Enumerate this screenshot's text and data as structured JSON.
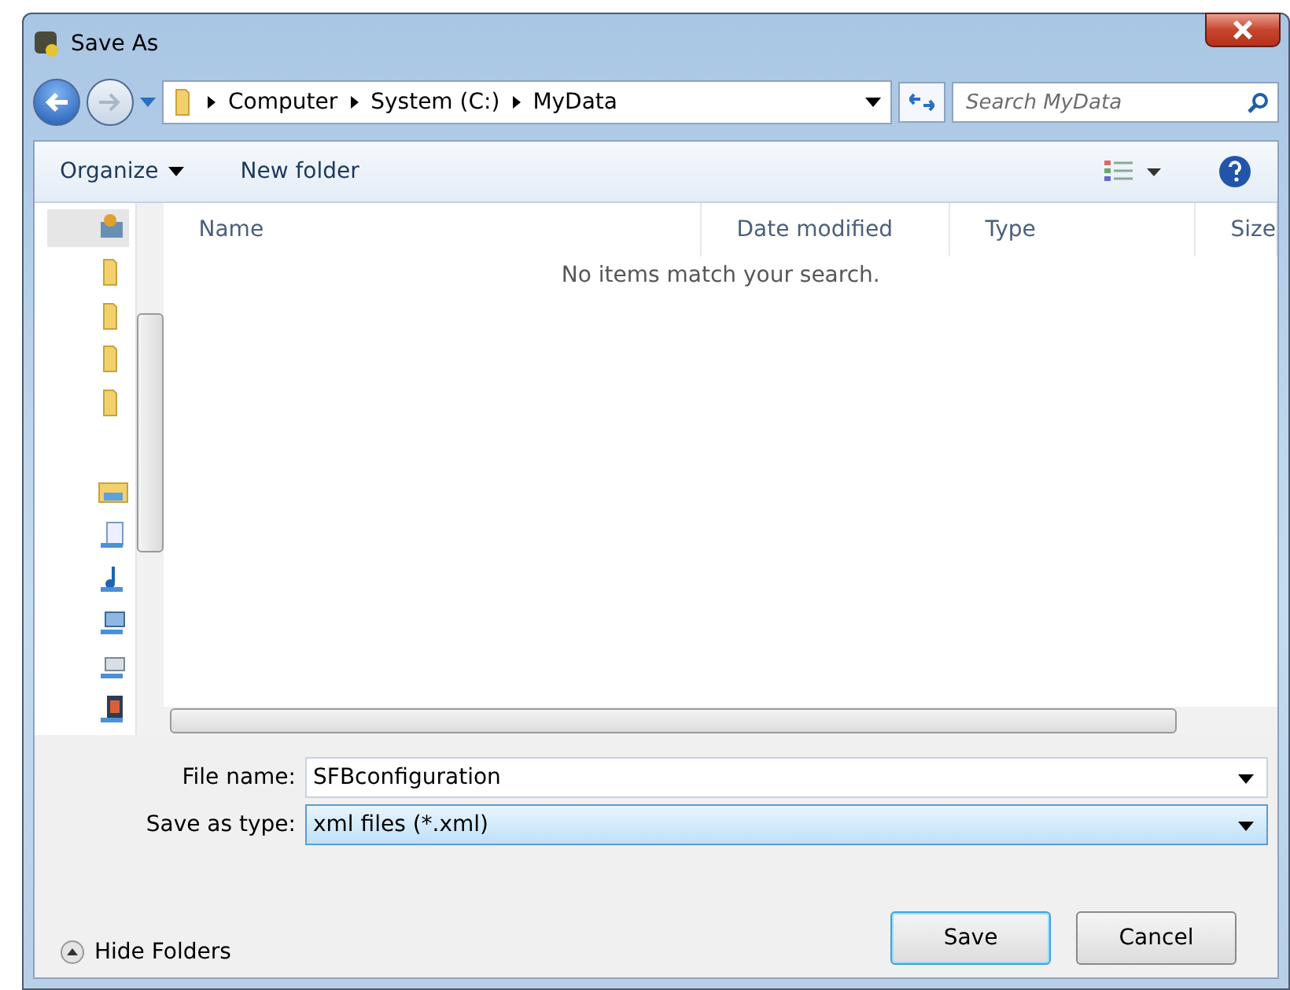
{
  "window": {
    "title": "Save As"
  },
  "address": {
    "crumbs": [
      "Computer",
      "System (C:)",
      "MyData"
    ]
  },
  "search": {
    "placeholder": "Search MyData"
  },
  "toolbar": {
    "organize": "Organize",
    "new_folder": "New folder"
  },
  "nav_pane": {
    "items": [
      {
        "kind": "library",
        "selected": true
      },
      {
        "kind": "folder",
        "selected": false
      },
      {
        "kind": "folder",
        "selected": false
      },
      {
        "kind": "folder",
        "selected": false
      },
      {
        "kind": "folder",
        "selected": false
      },
      {
        "kind": "libraries",
        "selected": false
      },
      {
        "kind": "document",
        "selected": false
      },
      {
        "kind": "music",
        "selected": false
      },
      {
        "kind": "computer",
        "selected": false
      },
      {
        "kind": "drive",
        "selected": false
      },
      {
        "kind": "video",
        "selected": false
      }
    ]
  },
  "table": {
    "columns": [
      "Name",
      "Date modified",
      "Type",
      "Size"
    ],
    "empty_message": "No items match your search."
  },
  "form": {
    "file_name_label": "File name:",
    "file_name": "SFBconfiguration",
    "type_label": "Save as type:",
    "type_value": "xml files (*.xml)"
  },
  "hide_folders": "Hide Folders",
  "buttons": [
    {
      "label": "Save",
      "default": true
    },
    {
      "label": "Cancel",
      "default": false
    }
  ]
}
